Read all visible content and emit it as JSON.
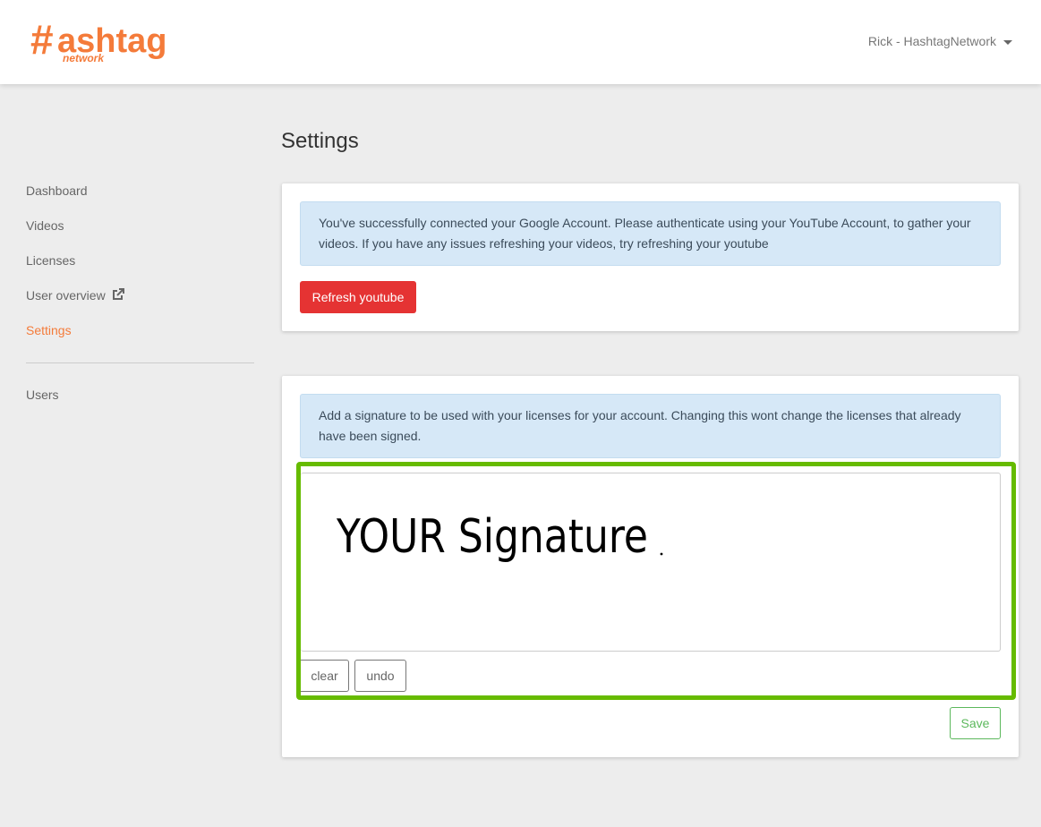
{
  "header": {
    "logo_text": "#ashtag",
    "logo_sub": "network",
    "user_menu": "Rick - HashtagNetwork",
    "brand_color": "#f47b3a"
  },
  "sidebar": {
    "items": [
      {
        "label": "Dashboard"
      },
      {
        "label": "Videos"
      },
      {
        "label": "Licenses"
      },
      {
        "label": "User overview",
        "icon": "external-link-icon"
      },
      {
        "label": "Settings",
        "active": true
      }
    ],
    "admin_items": [
      {
        "label": "Users"
      }
    ]
  },
  "main": {
    "title": "Settings",
    "youtube_card": {
      "message": "You've successfully connected your Google Account. Please authenticate using your YouTube Account, to gather your videos. If you have any issues refreshing your videos, try refreshing your youtube",
      "button": "Refresh youtube"
    },
    "signature_card": {
      "message": "Add a signature to be used with your licenses for your account. Changing this wont change the licenses that already have been signed.",
      "signature_drawing": "YOUR Signature",
      "clear": "clear",
      "undo": "undo",
      "save": "Save",
      "highlight_color": "#66bb00"
    }
  }
}
